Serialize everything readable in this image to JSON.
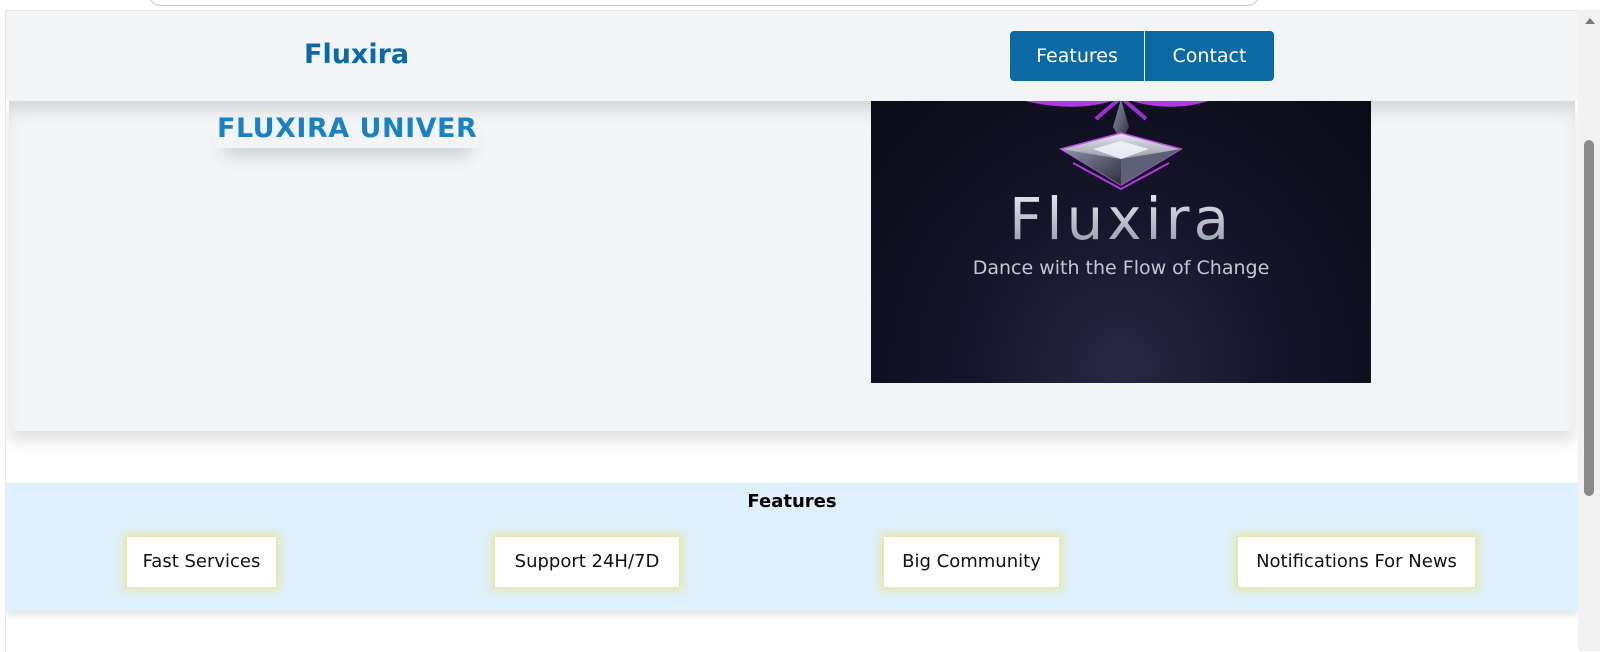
{
  "navbar": {
    "brand": "Fluxira",
    "buttons": [
      {
        "label": "Features"
      },
      {
        "label": "Contact"
      }
    ]
  },
  "hero": {
    "title": "FLUXIRA UNIVER",
    "image": {
      "logo_word": "Fluxira",
      "tagline": "Dance with the Flow of Change"
    }
  },
  "features": {
    "heading": "Features",
    "items": [
      {
        "label": "Fast Services"
      },
      {
        "label": "Support 24H/7D"
      },
      {
        "label": "Big Community"
      },
      {
        "label": "Notifications For News"
      }
    ]
  },
  "colors": {
    "brand_blue": "#0a6aa1",
    "button_blue": "#0b6aa3",
    "hero_bg": "#f3f4f6",
    "features_bg": "#def0fb",
    "card_glow": "#e8e278",
    "logo_purple": "#b23be0"
  }
}
